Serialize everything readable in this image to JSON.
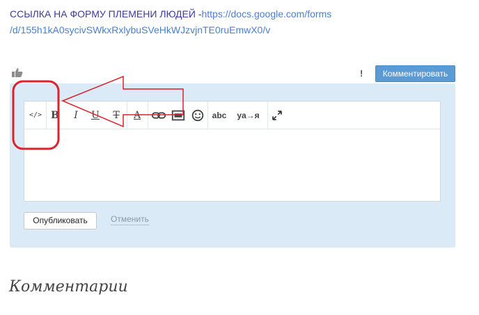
{
  "post": {
    "text_prefix": "ССЫЛКА НА ФОРМУ ПЛЕМЕНИ ЛЮДЕЙ -",
    "link_line1": "https://docs.google.com/forms",
    "link_line2": "/d/155h1kA0sycivSWkxRxlybuSVeHkWJzvjnTE0ruEmwX0/v"
  },
  "actions": {
    "report": "!",
    "comment_button": "Комментировать"
  },
  "toolbar": {
    "code": "</>",
    "bold": "B",
    "italic": "I",
    "underline": "U",
    "strike": "T",
    "color": "A",
    "spell": "abc",
    "translit": "ya→я",
    "emoji_icon": "smile-icon",
    "link_icon": "link-icon",
    "image_icon": "image-icon",
    "expand_icon": "expand-icon"
  },
  "editor": {
    "value": ""
  },
  "form": {
    "publish": "Опубликовать",
    "cancel": "Отменить"
  },
  "comments": {
    "title": "Комментарии"
  },
  "colors": {
    "accent": "#5b9bd5",
    "panel": "#daeaf7",
    "annotation_red": "#d9232d"
  }
}
